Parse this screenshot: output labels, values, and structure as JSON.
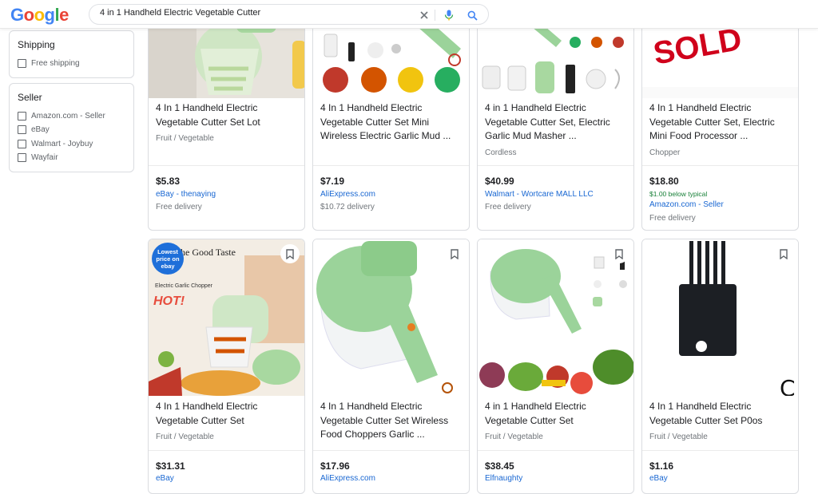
{
  "search": {
    "query": "4 in 1 Handheld Electric Vegetable Cutter"
  },
  "filters": {
    "shipping": {
      "title": "Shipping",
      "options": [
        "Free shipping"
      ]
    },
    "seller": {
      "title": "Seller",
      "options": [
        "Amazon.com - Seller",
        "eBay",
        "Walmart - Joybuy",
        "Wayfair"
      ]
    }
  },
  "row1": [
    {
      "title": "4 In 1 Handheld Electric Vegetable Cutter Set Lot",
      "category": "Fruit / Vegetable",
      "price": "$5.83",
      "seller": "eBay - thenaying",
      "delivery": "Free delivery"
    },
    {
      "title": "4 In 1 Handheld Electric Vegetable Cutter Set Mini Wireless Electric Garlic Mud ...",
      "category": "",
      "price": "$7.19",
      "seller": "AliExpress.com",
      "delivery": "$10.72 delivery"
    },
    {
      "title": "4 in 1 Handheld Electric Vegetable Cutter Set, Electric Garlic Mud Masher ...",
      "category": "Cordless",
      "price": "$40.99",
      "seller": "Walmart - Wortcare MALL LLC",
      "delivery": "Free delivery"
    },
    {
      "title": "4 In 1 Handheld Electric Vegetable Cutter Set, Electric Mini Food Processor ...",
      "category": "Chopper",
      "price": "$18.80",
      "below": "$1.00 below typical",
      "seller": "Amazon.com - Seller",
      "delivery": "Free delivery",
      "image_text": "SOLD"
    }
  ],
  "row2": [
    {
      "title": "4 In 1 Handheld Electric Vegetable Cutter Set",
      "category": "Fruit / Vegetable",
      "price": "$31.31",
      "seller": "eBay",
      "badge": "Lowest price on ebay",
      "image_caption": "he Good Taste",
      "image_sub": "Electric Garlic Chopper",
      "image_hot": "HOT!"
    },
    {
      "title": "4 In 1 Handheld Electric Vegetable Cutter Set Wireless Food Choppers Garlic ...",
      "category": "",
      "price": "$17.96",
      "seller": "AliExpress.com"
    },
    {
      "title": "4 in 1 Handheld Electric Vegetable Cutter Set",
      "category": "Fruit / Vegetable",
      "price": "$38.45",
      "seller": "Elfnaughty"
    },
    {
      "title": "4 In 1 Handheld Electric Vegetable Cutter Set P0os",
      "category": "Fruit / Vegetable",
      "price": "$1.16",
      "seller": "eBay",
      "image_letter": "C"
    }
  ],
  "icons": {
    "clear": "close-icon",
    "voice": "mic-icon",
    "search": "search-icon",
    "save": "bookmark-icon"
  },
  "colors": {
    "google_blue": "#4285f4",
    "google_red": "#ea4335",
    "google_yellow": "#fbbc05",
    "google_green": "#34a853",
    "link": "#1967d2",
    "product_green": "#9bd39a"
  }
}
